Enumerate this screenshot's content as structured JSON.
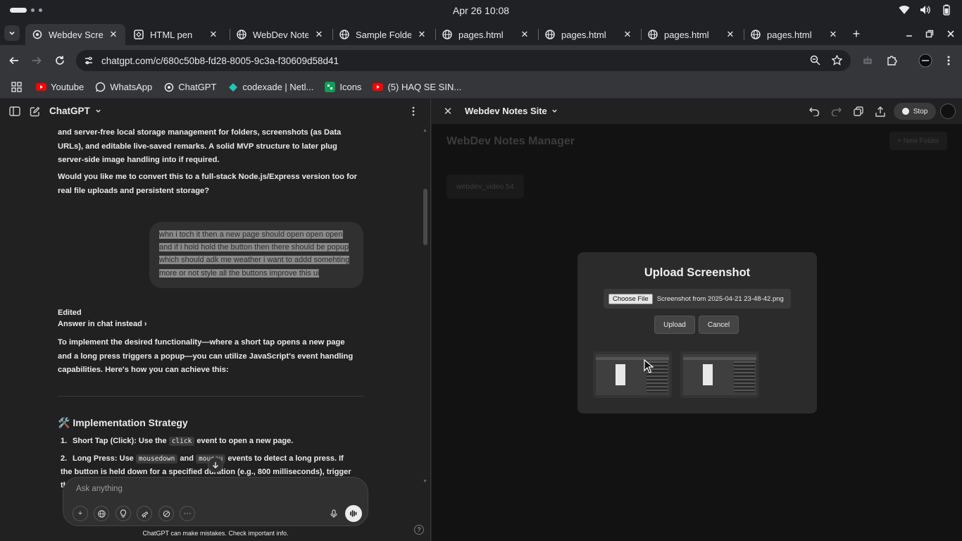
{
  "os": {
    "clock": "Apr 26  10:08"
  },
  "tabs": [
    {
      "title": "Webdev Scre",
      "active": true,
      "icon": "chatgpt-icon"
    },
    {
      "title": "HTML pen",
      "active": false,
      "icon": "codepen-icon"
    },
    {
      "title": "WebDev Note",
      "active": false,
      "icon": "globe-icon"
    },
    {
      "title": "Sample Folde",
      "active": false,
      "icon": "globe-icon"
    },
    {
      "title": "pages.html",
      "active": false,
      "icon": "globe-icon"
    },
    {
      "title": "pages.html",
      "active": false,
      "icon": "globe-icon"
    },
    {
      "title": "pages.html",
      "active": false,
      "icon": "globe-icon"
    },
    {
      "title": "pages.html",
      "active": false,
      "icon": "globe-icon"
    }
  ],
  "address": {
    "url": "chatgpt.com/c/680c50b8-fd28-8005-9c3a-f30609d58d41"
  },
  "bookmarks": [
    {
      "label": "Youtube",
      "icon": "youtube-icon",
      "color": "#ff0000"
    },
    {
      "label": "WhatsApp",
      "icon": "whatsapp-icon",
      "color": "#ffffff"
    },
    {
      "label": "ChatGPT",
      "icon": "chatgpt-icon",
      "color": "#ffffff"
    },
    {
      "label": "codexade | Netl...",
      "icon": "netlify-icon",
      "color": "#20c6b7"
    },
    {
      "label": "Icons",
      "icon": "icons-icon",
      "color": "#0f9d58"
    },
    {
      "label": "(5) HAQ SE SIN...",
      "icon": "youtube-icon",
      "color": "#ff0000"
    }
  ],
  "chat": {
    "model": "ChatGPT",
    "para1": "and server-free local storage management for folders, screenshots (as Data URLs), and editable live-saved remarks. A solid MVP structure to later plug server-side image handling into if required.",
    "para2": "Would you like me to convert this to a full-stack Node.js/Express version too for real file uploads and persistent storage?",
    "user_message": "whn i toch it then a new page should open open open and if i hold hold the button then there should be popup which should adk me weather i want to addd somehting more or not                    style all the buttons    improve this ui",
    "edited": "Edited",
    "answer_in_chat": "Answer in chat instead",
    "para3": "To implement the desired functionality—where a short tap opens a new page and a long press triggers a popup—you can utilize JavaScript's event handling capabilities. Here's how you can achieve this:",
    "heading_emoji": "🛠️",
    "heading": "Implementation Strategy",
    "list": [
      {
        "num": "1.",
        "pre": "Short Tap (Click): Use the ",
        "code1": "click",
        "mid": " event to open a new page.",
        "code2": "",
        "post": ""
      },
      {
        "num": "2.",
        "pre": "Long Press: Use ",
        "code1": "mousedown",
        "mid": " and ",
        "code2": "mouseu",
        "post": " events to detect a long press. If the button is held down for a specified duration (e.g., 800 milliseconds), trigger the"
      }
    ],
    "composer_placeholder": "Ask anything",
    "disclaimer": "ChatGPT can make mistakes. Check important info.",
    "help": "?"
  },
  "canvas": {
    "title": "Webdev Notes Site",
    "stop_label": "Stop",
    "preview": {
      "app_title": "WebDev Notes Manager",
      "new_folder": "+ New Folder",
      "folder_name": "webdev_video 54"
    },
    "modal": {
      "title": "Upload Screenshot",
      "choose_file": "Choose File",
      "file_name": "Screenshot from 2025-04-21 23-48-42.png",
      "upload": "Upload",
      "cancel": "Cancel"
    }
  }
}
